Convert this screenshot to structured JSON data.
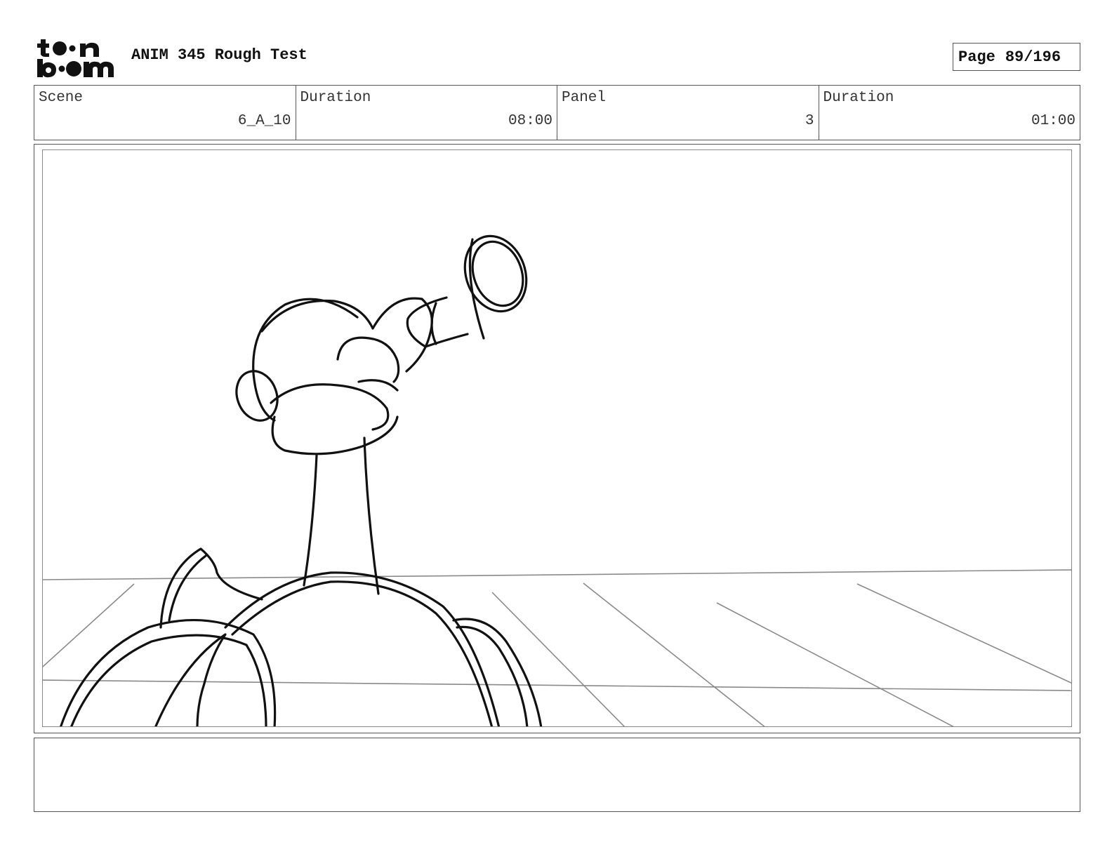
{
  "header": {
    "title": "ANIM 345 Rough Test",
    "page_label": "Page",
    "page_value": "89/196"
  },
  "info": {
    "scene_label": "Scene",
    "scene_value": "6_A_10",
    "scene_duration_label": "Duration",
    "scene_duration_value": "08:00",
    "panel_label": "Panel",
    "panel_value": "3",
    "panel_duration_label": "Duration",
    "panel_duration_value": "01:00"
  },
  "notes": {
    "text": ""
  }
}
